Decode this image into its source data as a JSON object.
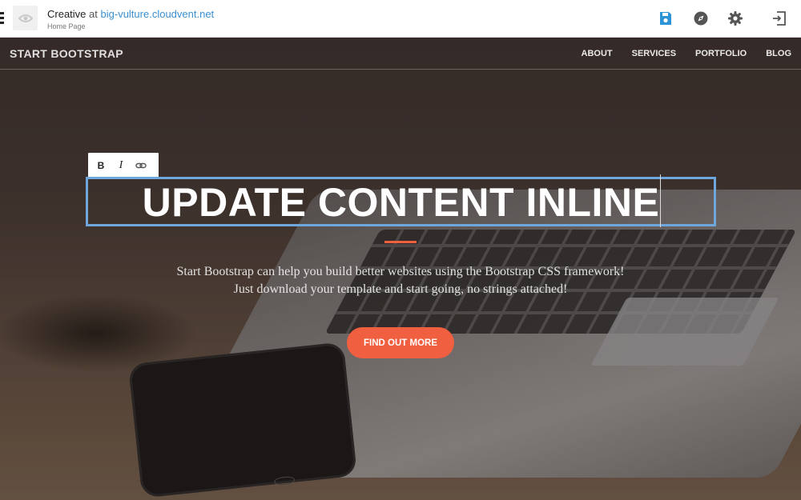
{
  "cms": {
    "site_name": "Creative",
    "at": "at",
    "domain": "big-vulture.cloudvent.net",
    "page_name": "Home Page",
    "tools": [
      "save-icon",
      "compass-icon",
      "gear-icon",
      "exit-icon"
    ],
    "colors": {
      "save": "#2c93d6",
      "tool": "#555555"
    }
  },
  "navbar": {
    "brand": "START BOOTSTRAP",
    "links": [
      "ABOUT",
      "SERVICES",
      "PORTFOLIO",
      "BLOG"
    ]
  },
  "editor": {
    "bold_label": "B",
    "italic_label": "I",
    "link_icon": "link-icon",
    "selection_color": "#6fa7dc"
  },
  "hero": {
    "heading": "UPDATE CONTENT INLINE",
    "lead_line1": "Start Bootstrap can help you build better websites using the Bootstrap CSS framework!",
    "lead_line2": "Just download your template and start going, no strings attached!",
    "cta": "FIND OUT MORE",
    "accent": "#f05f40"
  }
}
